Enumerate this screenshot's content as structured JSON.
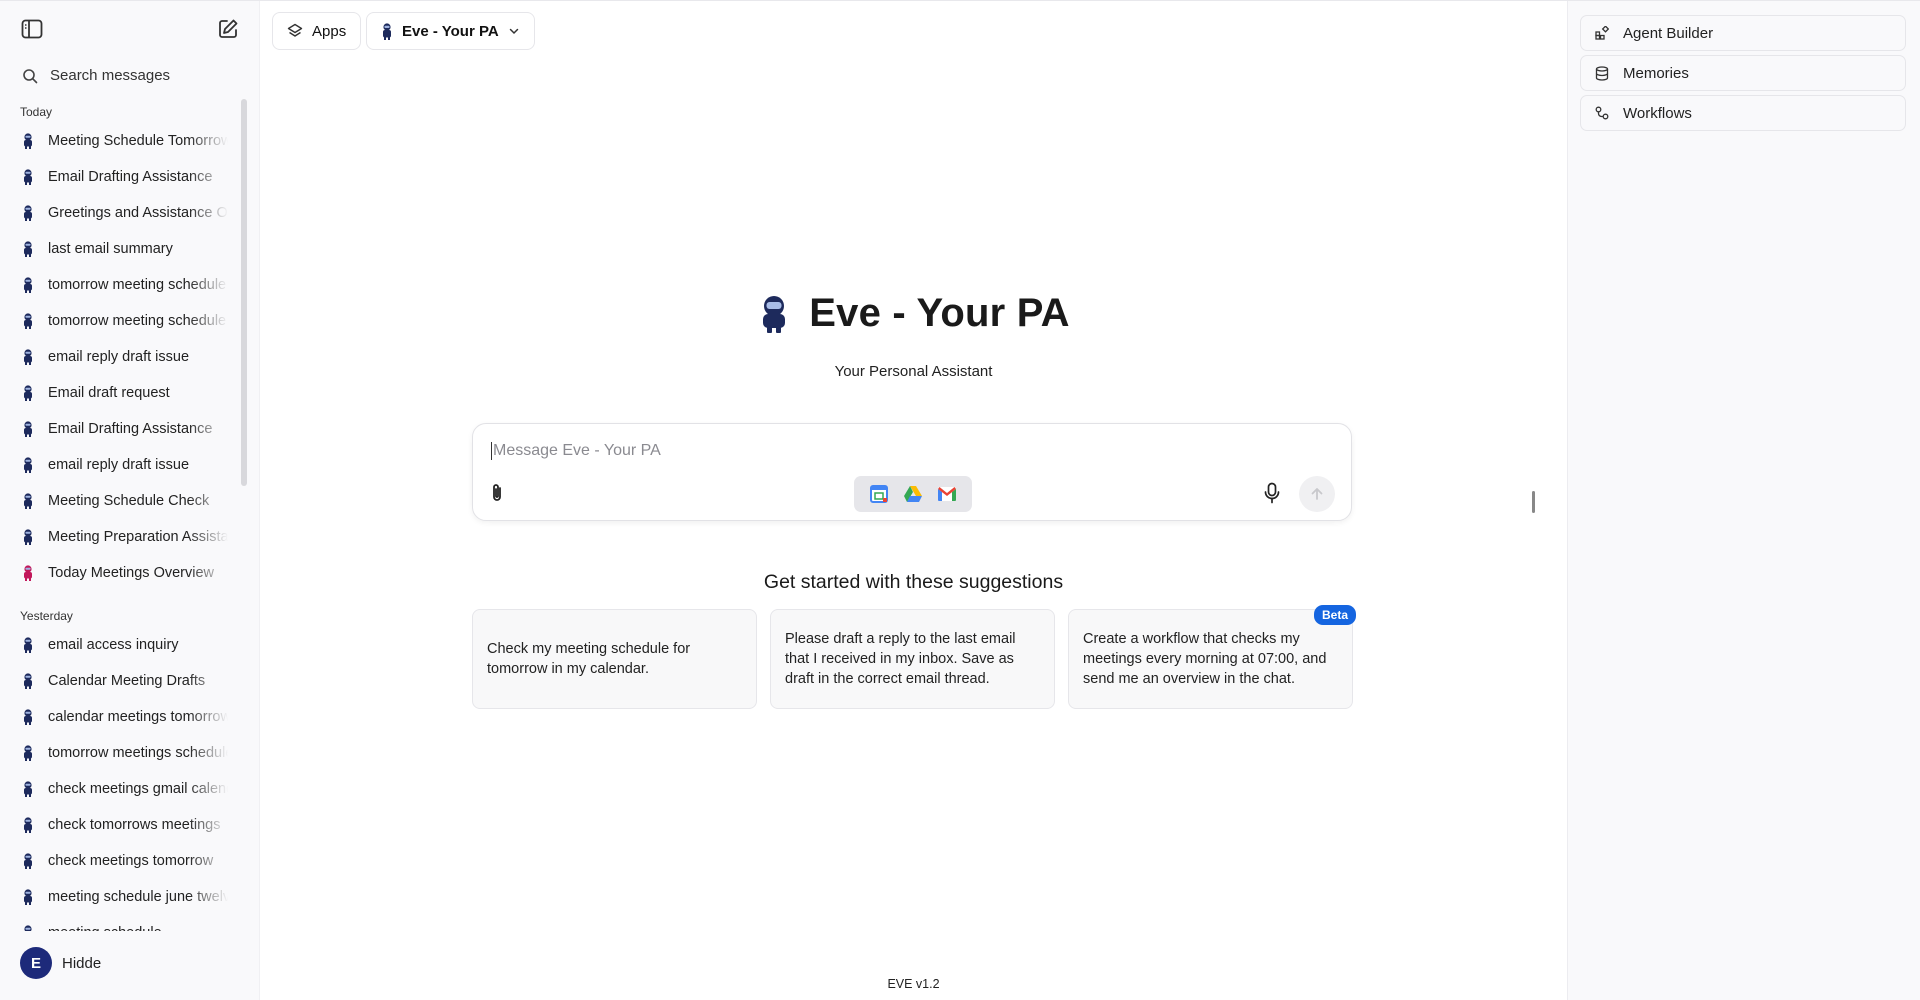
{
  "sidebar": {
    "search_placeholder": "Search messages",
    "sections": [
      {
        "label": "Today",
        "items": [
          {
            "label": "Meeting Schedule Tomorrow",
            "avatar": "#1d2a5c"
          },
          {
            "label": "Email Drafting Assistance",
            "avatar": "#1d2a5c"
          },
          {
            "label": "Greetings and Assistance Offered",
            "avatar": "#1d2a5c"
          },
          {
            "label": "last email summary",
            "avatar": "#1d2a5c"
          },
          {
            "label": "tomorrow meeting schedule",
            "avatar": "#1d2a5c"
          },
          {
            "label": "tomorrow meeting schedule",
            "avatar": "#1d2a5c"
          },
          {
            "label": "email reply draft issue",
            "avatar": "#1d2a5c"
          },
          {
            "label": "Email draft request",
            "avatar": "#1d2a5c"
          },
          {
            "label": "Email Drafting Assistance",
            "avatar": "#1d2a5c"
          },
          {
            "label": "email reply draft issue",
            "avatar": "#1d2a5c"
          },
          {
            "label": "Meeting Schedule Check",
            "avatar": "#1d2a5c"
          },
          {
            "label": "Meeting Preparation Assistance",
            "avatar": "#1d2a5c"
          },
          {
            "label": "Today Meetings Overview",
            "avatar": "#c2185b"
          }
        ]
      },
      {
        "label": "Yesterday",
        "items": [
          {
            "label": "email access inquiry",
            "avatar": "#1d2a5c"
          },
          {
            "label": "Calendar Meeting Drafts",
            "avatar": "#1d2a5c"
          },
          {
            "label": "calendar meetings tomorrow",
            "avatar": "#1d2a5c"
          },
          {
            "label": "tomorrow meetings schedule",
            "avatar": "#1d2a5c"
          },
          {
            "label": "check meetings gmail calendar",
            "avatar": "#1d2a5c"
          },
          {
            "label": "check tomorrows meetings",
            "avatar": "#1d2a5c"
          },
          {
            "label": "check meetings tomorrow",
            "avatar": "#1d2a5c"
          },
          {
            "label": "meeting schedule june twelve",
            "avatar": "#1d2a5c"
          },
          {
            "label": "meeting schedule",
            "avatar": "#1d2a5c"
          }
        ]
      }
    ],
    "user": {
      "name": "Hidde",
      "avatar_letter": "E",
      "avatar_color": "#1d2a7a"
    }
  },
  "header": {
    "apps_label": "Apps",
    "agent_label": "Eve - Your PA"
  },
  "hero": {
    "title": "Eve - Your PA",
    "subtitle": "Your Personal Assistant"
  },
  "composer": {
    "placeholder": "Message Eve - Your PA",
    "integrations": [
      "google-calendar-icon",
      "google-drive-icon",
      "gmail-icon"
    ]
  },
  "suggestions": {
    "title": "Get started with these suggestions",
    "items": [
      {
        "text": "Check my meeting schedule for tomorrow in my calendar.",
        "badge": ""
      },
      {
        "text": "Please draft a reply to the last email that I received in my inbox. Save as draft in the correct email thread.",
        "badge": ""
      },
      {
        "text": "Create a workflow that checks my meetings every morning at 07:00, and send me an overview in the chat.",
        "badge": "Beta"
      }
    ]
  },
  "right_panel": {
    "items": [
      {
        "label": "Agent Builder",
        "icon": "agent-builder-icon"
      },
      {
        "label": "Memories",
        "icon": "database-icon"
      },
      {
        "label": "Workflows",
        "icon": "workflow-icon"
      }
    ]
  },
  "footer": {
    "version": "EVE v1.2"
  },
  "colors": {
    "accent": "#1565e0",
    "brand_dark": "#1d2a5c"
  }
}
